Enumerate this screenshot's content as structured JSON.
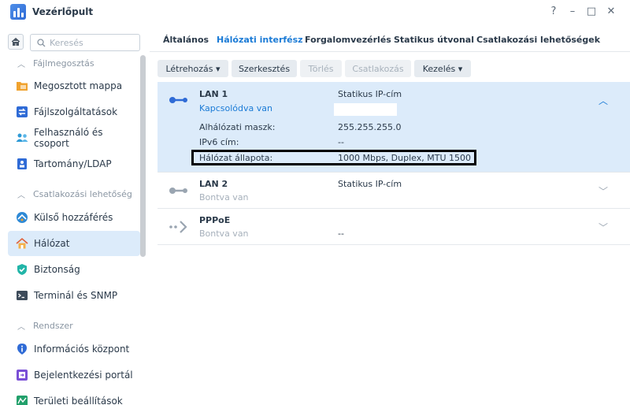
{
  "window": {
    "title": "Vezérlőpult",
    "controls": {
      "help": "?",
      "minimize": "–",
      "maximize": "□",
      "close": "✕"
    }
  },
  "search": {
    "placeholder": "Keresés",
    "value": ""
  },
  "sidebar": {
    "groups": [
      {
        "label": "Fájlmegosztás"
      },
      {
        "label": "Csatlakozási lehetőség"
      },
      {
        "label": "Rendszer"
      }
    ],
    "items": [
      {
        "label": "Megosztott mappa",
        "icon": "shared-folder-icon"
      },
      {
        "label": "Fájlszolgáltatások",
        "icon": "file-services-icon"
      },
      {
        "label": "Felhasználó és csoport",
        "icon": "user-group-icon"
      },
      {
        "label": "Tartomány/LDAP",
        "icon": "domain-icon"
      },
      {
        "label": "Külső hozzáférés",
        "icon": "external-access-icon"
      },
      {
        "label": "Hálózat",
        "icon": "network-house-icon"
      },
      {
        "label": "Biztonság",
        "icon": "security-shield-icon"
      },
      {
        "label": "Terminál és SNMP",
        "icon": "terminal-icon"
      },
      {
        "label": "Információs központ",
        "icon": "info-center-icon"
      },
      {
        "label": "Bejelentkezési portál",
        "icon": "login-portal-icon"
      },
      {
        "label": "Területi beállítások",
        "icon": "regional-options-icon"
      }
    ]
  },
  "tabs": [
    "Általános",
    "Hálózati interfész",
    "Forgalomvezérlés",
    "Statikus útvonal",
    "Csatlakozási lehetőségek"
  ],
  "active_tab": "Hálózati interfész",
  "toolbar": {
    "create": "Létrehozás ▾",
    "edit": "Szerkesztés",
    "delete": "Törlés",
    "connect": "Csatlakozás",
    "manage": "Kezelés ▾"
  },
  "interfaces": [
    {
      "name": "LAN 1",
      "status": "Kapcsolódva van",
      "type": "Statikus IP-cím",
      "details": {
        "subnet_label": "Alhálózati maszk:",
        "subnet_value": "255.255.255.0",
        "ipv6_label": "IPv6 cím:",
        "ipv6_value": "--",
        "state_label": "Hálózat állapota:",
        "state_value": "1000 Mbps, Duplex, MTU 1500"
      }
    },
    {
      "name": "LAN 2",
      "status": "Bontva van",
      "type": "Statikus IP-cím"
    },
    {
      "name": "PPPoE",
      "status": "Bontva van",
      "type": "--"
    }
  ],
  "colors": {
    "accent": "#1b7bd6",
    "selected_bg": "#dcebfa",
    "connected_icon": "#2f6bd6",
    "disconnected_icon": "#9aa5b1"
  }
}
